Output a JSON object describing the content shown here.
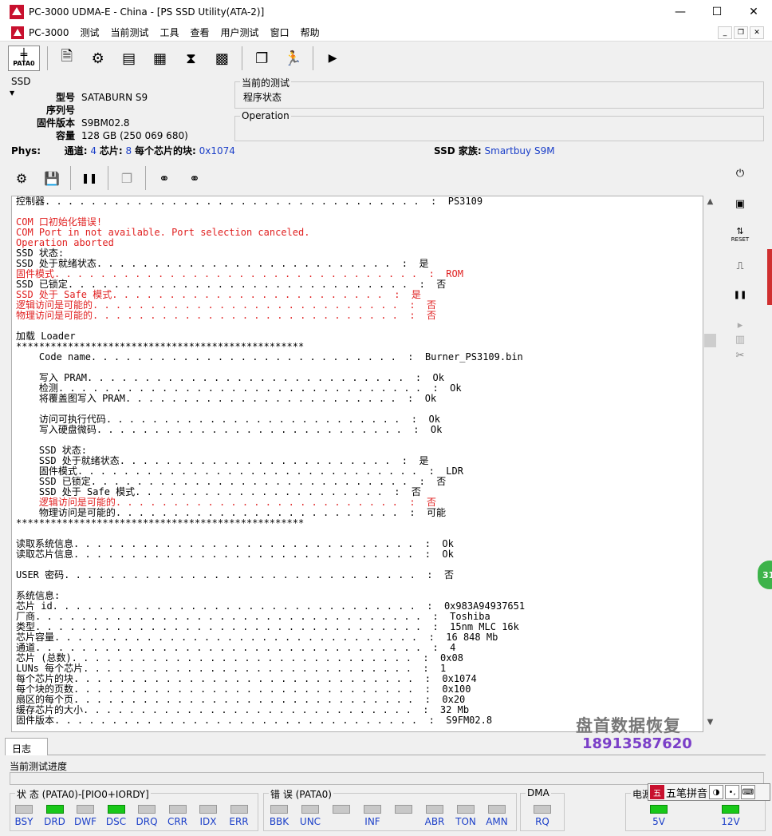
{
  "window": {
    "title": "PC-3000 UDMA-E - China - [PS SSD Utility(ATA-2)]",
    "controls": [
      "—",
      "☐",
      "✕"
    ]
  },
  "menu": {
    "items": [
      "PC-3000",
      "测试",
      "当前测试",
      "工具",
      "查看",
      "用户测试",
      "窗口",
      "帮助"
    ]
  },
  "toolbar": {
    "pata_label": "PATA0"
  },
  "ssd": {
    "label": "SSD",
    "rows": [
      {
        "key": "型号",
        "value": "SATABURN   S9"
      },
      {
        "key": "序列号",
        "value": ""
      },
      {
        "key": "固件版本",
        "value": "S9BM02.8"
      },
      {
        "key": "容量",
        "value": "128 GB (250 069 680)"
      }
    ]
  },
  "current_test": {
    "title": "当前的测试",
    "value": "程序状态"
  },
  "operation": {
    "title": "Operation"
  },
  "phys": {
    "label": "Phys:",
    "channels_label": "通道:",
    "channels": "4",
    "chips_label": "芯片:",
    "chips": "8",
    "blocks_label": "每个芯片的块:",
    "blocks": "0x1074",
    "family_label": "SSD 家族:",
    "family": "Smartbuy S9M"
  },
  "log": [
    {
      "t": "控制器. . . . . . . . . . . . . . . . . . . . . . . . . . . . . . . . .  :  PS3109",
      "c": ""
    },
    {
      "t": "",
      "c": ""
    },
    {
      "t": "COM 口初始化错误!",
      "c": "red"
    },
    {
      "t": "COM Port in not available. Port selection canceled.",
      "c": "red"
    },
    {
      "t": "Operation aborted",
      "c": "red"
    },
    {
      "t": "SSD 状态:",
      "c": ""
    },
    {
      "t": "SSD 处于就绪状态. . . . . . . . . . . . . . . . . . . . . . . . . .  :  是",
      "c": ""
    },
    {
      "t": "固件模式. . . . . . . . . . . . . . . . . . . . . . . . . . . . . . . .  :  ROM",
      "c": "red"
    },
    {
      "t": "SSD 已锁定. . . . . . . . . . . . . . . . . . . . . . . . . . . . . .  :  否",
      "c": ""
    },
    {
      "t": "SSD 处于 Safe 模式. . . . . . . . . . . . . . . . . . . . . . . .  :  是",
      "c": "red"
    },
    {
      "t": "逻辑访问是可能的. . . . . . . . . . . . . . . . . . . . . . . . . . .  :  否",
      "c": "red"
    },
    {
      "t": "物理访问是可能的. . . . . . . . . . . . . . . . . . . . . . . . . . .  :  否",
      "c": "red"
    },
    {
      "t": "",
      "c": ""
    },
    {
      "t": "加载 Loader",
      "c": ""
    },
    {
      "t": "**************************************************",
      "c": ""
    },
    {
      "t": "    Code name. . . . . . . . . . . . . . . . . . . . . . . . . . .  :  Burner_PS3109.bin",
      "c": ""
    },
    {
      "t": "",
      "c": ""
    },
    {
      "t": "    写入 PRAM. . . . . . . . . . . . . . . . . . . . . . . . . . . .  :  Ok",
      "c": ""
    },
    {
      "t": "    检测. . . . . . . . . . . . . . . . . . . . . . . . . . . . . . . .  :  Ok",
      "c": ""
    },
    {
      "t": "    将覆盖图写入 PRAM. . . . . . . . . . . . . . . . . . . . . . . .  :  Ok",
      "c": ""
    },
    {
      "t": "",
      "c": ""
    },
    {
      "t": "    访问可执行代码. . . . . . . . . . . . . . . . . . . . . . . . . .  :  Ok",
      "c": ""
    },
    {
      "t": "    写入硬盘微码. . . . . . . . . . . . . . . . . . . . . . . . . . .  :  Ok",
      "c": ""
    },
    {
      "t": "",
      "c": ""
    },
    {
      "t": "    SSD 状态:",
      "c": ""
    },
    {
      "t": "    SSD 处于就绪状态. . . . . . . . . . . . . . . . . . . . . . . .  :  是",
      "c": ""
    },
    {
      "t": "    固件模式. . . . . . . . . . . . . . . . . . . . . . . . . . . . . .  :  LDR",
      "c": ""
    },
    {
      "t": "    SSD 已锁定. . . . . . . . . . . . . . . . . . . . . . . . . . . .  :  否",
      "c": ""
    },
    {
      "t": "    SSD 处于 Safe 模式. . . . . . . . . . . . . . . . . . . . . .  :  否",
      "c": ""
    },
    {
      "t": "    逻辑访问是可能的. . . . . . . . . . . . . . . . . . . . . . . . .  :  否",
      "c": "red"
    },
    {
      "t": "    物理访问是可能的. . . . . . . . . . . . . . . . . . . . . . . . .  :  可能",
      "c": ""
    },
    {
      "t": "**************************************************",
      "c": ""
    },
    {
      "t": "",
      "c": ""
    },
    {
      "t": "读取系统信息. . . . . . . . . . . . . . . . . . . . . . . . . . . . . .  :  Ok",
      "c": ""
    },
    {
      "t": "读取芯片信息. . . . . . . . . . . . . . . . . . . . . . . . . . . . . .  :  Ok",
      "c": ""
    },
    {
      "t": "",
      "c": ""
    },
    {
      "t": "USER 密码. . . . . . . . . . . . . . . . . . . . . . . . . . . . . . .  :  否",
      "c": ""
    },
    {
      "t": "",
      "c": ""
    },
    {
      "t": "系统信息:",
      "c": ""
    },
    {
      "t": "芯片 id. . . . . . . . . . . . . . . . . . . . . . . . . . . . . . . .  :  0x983A94937651",
      "c": ""
    },
    {
      "t": "厂商. . . . . . . . . . . . . . . . . . . . . . . . . . . . . . . . . .  :  Toshiba",
      "c": ""
    },
    {
      "t": "类型. . . . . . . . . . . . . . . . . . . . . . . . . . . . . . . . . .  :  15nm MLC 16k",
      "c": ""
    },
    {
      "t": "芯片容量. . . . . . . . . . . . . . . . . . . . . . . . . . . . . . . .  :  16 848 Mb",
      "c": ""
    },
    {
      "t": "通道. . . . . . . . . . . . . . . . . . . . . . . . . . . . . . . . . .  :  4",
      "c": ""
    },
    {
      "t": "芯片 (总数). . . . . . . . . . . . . . . . . . . . . . . . . . . . . .  :  0x08",
      "c": ""
    },
    {
      "t": "LUNs 每个芯片. . . . . . . . . . . . . . . . . . . . . . . . . . . . .  :  1",
      "c": ""
    },
    {
      "t": "每个芯片的块. . . . . . . . . . . . . . . . . . . . . . . . . . . . . .  :  0x1074",
      "c": ""
    },
    {
      "t": "每个块的页数. . . . . . . . . . . . . . . . . . . . . . . . . . . . . .  :  0x100",
      "c": ""
    },
    {
      "t": "扇区的每个页. . . . . . . . . . . . . . . . . . . . . . . . . . . . . .  :  0x20",
      "c": ""
    },
    {
      "t": "缓存芯片的大小. . . . . . . . . . . . . . . . . . . . . . . . . . . . .  :  32 Mb",
      "c": ""
    },
    {
      "t": "固件版本. . . . . . . . . . . . . . . . . . . . . . . . . . . . . . . .  :  S9FM02.8",
      "c": ""
    }
  ],
  "tabs": {
    "log": "日志"
  },
  "progress": {
    "label": "当前测试进度"
  },
  "status": {
    "state_title": "状 态 (PATA0)-[PIO0+IORDY]",
    "state_leds": [
      {
        "label": "BSY",
        "on": false
      },
      {
        "label": "DRD",
        "on": true
      },
      {
        "label": "DWF",
        "on": false
      },
      {
        "label": "DSC",
        "on": true
      },
      {
        "label": "DRQ",
        "on": false
      },
      {
        "label": "CRR",
        "on": false
      },
      {
        "label": "IDX",
        "on": false
      },
      {
        "label": "ERR",
        "on": false
      }
    ],
    "error_title": "错 误 (PATA0)",
    "error_leds": [
      {
        "label": "BBK",
        "on": false
      },
      {
        "label": "UNC",
        "on": false
      },
      {
        "label": "",
        "on": false
      },
      {
        "label": "INF",
        "on": false
      },
      {
        "label": "",
        "on": false
      },
      {
        "label": "ABR",
        "on": false
      },
      {
        "label": "TON",
        "on": false
      },
      {
        "label": "AMN",
        "on": false
      }
    ],
    "dma_title": "DMA",
    "dma_leds": [
      {
        "label": "RQ",
        "on": false
      }
    ],
    "power_title": "电源",
    "power_leds": [
      {
        "label": "5V",
        "on": true
      },
      {
        "label": "12V",
        "on": true
      }
    ]
  },
  "ime": {
    "label": "五笔拼音"
  },
  "watermark": {
    "line1": "盘首数据恢复",
    "line2": "18913587620"
  },
  "badge": {
    "text": "31"
  },
  "colors": {
    "error_red": "#e02020",
    "info_blue": "#1a3ec8",
    "led_on": "#18c818"
  }
}
